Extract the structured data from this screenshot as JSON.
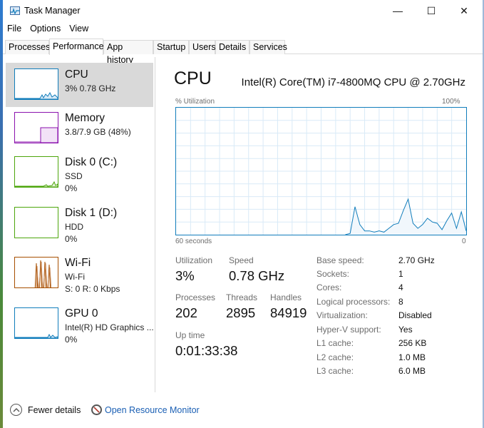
{
  "window": {
    "title": "Task Manager",
    "minimize": "—",
    "maximize": "☐",
    "close": "✕"
  },
  "menu": [
    "File",
    "Options",
    "View"
  ],
  "tabs": [
    "Processes",
    "Performance",
    "App history",
    "Startup",
    "Users",
    "Details",
    "Services"
  ],
  "active_tab": "Performance",
  "sidebar": [
    {
      "title": "CPU",
      "line1": "3%  0.78 GHz",
      "line2": ""
    },
    {
      "title": "Memory",
      "line1": "3.8/7.9 GB (48%)",
      "line2": ""
    },
    {
      "title": "Disk 0 (C:)",
      "line1": "SSD",
      "line2": "0%"
    },
    {
      "title": "Disk 1 (D:)",
      "line1": "HDD",
      "line2": "0%"
    },
    {
      "title": "Wi-Fi",
      "line1": "Wi-Fi",
      "line2": "S: 0  R: 0 Kbps"
    },
    {
      "title": "GPU 0",
      "line1": "Intel(R) HD Graphics ...",
      "line2": "0%"
    }
  ],
  "colors": {
    "cpu": "#117dbb",
    "memory": "#8b12ae",
    "disk": "#4da60c",
    "wifi": "#a74f01",
    "grid": "#d9eaf7",
    "selected": "#d9d9d9",
    "link": "#1a5fb4"
  },
  "main": {
    "title": "CPU",
    "model": "Intel(R) Core(TM) i7-4800MQ CPU @ 2.70GHz",
    "util_label": "% Utilization",
    "util_max": "100%",
    "time_label": "60 seconds",
    "min_label": "0"
  },
  "stats": {
    "utilization_label": "Utilization",
    "utilization": "3%",
    "speed_label": "Speed",
    "speed": "0.78 GHz",
    "processes_label": "Processes",
    "processes": "202",
    "threads_label": "Threads",
    "threads": "2895",
    "handles_label": "Handles",
    "handles": "84919",
    "uptime_label": "Up time",
    "uptime": "0:01:33:38"
  },
  "details": [
    {
      "label": "Base speed:",
      "value": "2.70 GHz"
    },
    {
      "label": "Sockets:",
      "value": "1"
    },
    {
      "label": "Cores:",
      "value": "4"
    },
    {
      "label": "Logical processors:",
      "value": "8"
    },
    {
      "label": "Virtualization:",
      "value": "Disabled"
    },
    {
      "label": "Hyper-V support:",
      "value": "Yes"
    },
    {
      "label": "L1 cache:",
      "value": "256 KB"
    },
    {
      "label": "L2 cache:",
      "value": "1.0 MB"
    },
    {
      "label": "L3 cache:",
      "value": "6.0 MB"
    }
  ],
  "footer": {
    "fewer_details": "Fewer details",
    "resource_monitor": "Open Resource Monitor"
  },
  "chart_data": {
    "type": "area",
    "x": [
      60,
      59,
      58,
      57,
      56,
      55,
      54,
      53,
      52,
      51,
      50,
      49,
      48,
      47,
      46,
      45,
      44,
      43,
      42,
      41,
      40,
      39,
      38,
      37,
      36,
      35,
      34,
      33,
      32,
      31,
      30,
      29,
      28,
      27,
      26,
      25,
      24,
      23,
      22,
      21,
      20,
      19,
      18,
      17,
      16,
      15,
      14,
      13,
      12,
      11,
      10,
      9,
      8,
      7,
      6,
      5,
      4,
      3,
      2,
      1,
      0
    ],
    "values": [
      0,
      0,
      0,
      0,
      0,
      0,
      0,
      0,
      0,
      0,
      0,
      0,
      0,
      0,
      0,
      0,
      0,
      0,
      0,
      0,
      0,
      0,
      0,
      0,
      0,
      0,
      0,
      0,
      0,
      0,
      0,
      0,
      0,
      0,
      0,
      0,
      1,
      22,
      8,
      3,
      3,
      2,
      3,
      2,
      5,
      8,
      9,
      19,
      28,
      9,
      5,
      8,
      13,
      10,
      9,
      4,
      11,
      17,
      5,
      18,
      3
    ],
    "xlim": [
      60,
      0
    ],
    "ylim": [
      0,
      100
    ],
    "grid": true
  }
}
